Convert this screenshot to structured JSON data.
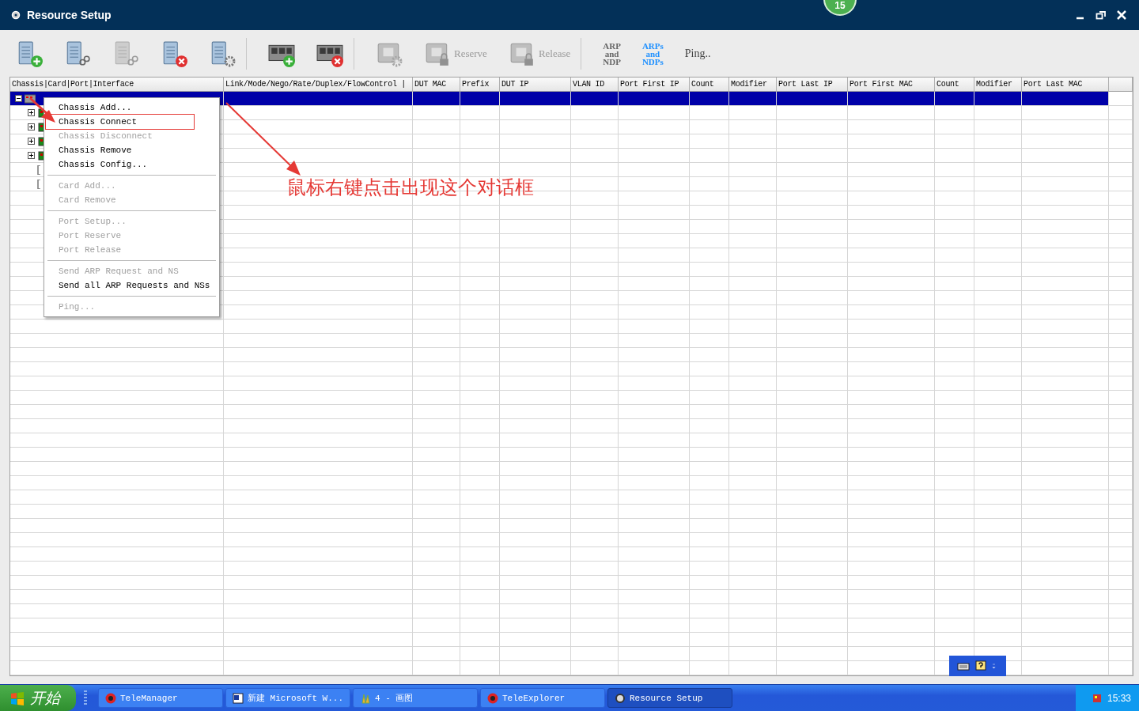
{
  "window": {
    "title": "Resource Setup",
    "badge": "15"
  },
  "toolbar": [
    {
      "kind": "icon",
      "disabled": false
    },
    {
      "kind": "icon",
      "disabled": false
    },
    {
      "kind": "icon",
      "disabled": true
    },
    {
      "kind": "icon",
      "disabled": false
    },
    {
      "kind": "icon",
      "disabled": false
    },
    {
      "kind": "separator"
    },
    {
      "kind": "icon",
      "disabled": false
    },
    {
      "kind": "icon",
      "disabled": false
    },
    {
      "kind": "separator"
    },
    {
      "kind": "icon",
      "disabled": true
    },
    {
      "kind": "icon",
      "disabled": true,
      "label": "Reserve"
    },
    {
      "kind": "icon",
      "disabled": true,
      "label": "Release"
    },
    {
      "kind": "separator"
    },
    {
      "kind": "stack",
      "lines": [
        "ARP",
        "and",
        "NDP"
      ],
      "disabled": true
    },
    {
      "kind": "stack",
      "lines": [
        "ARPs",
        "and",
        "NDPs"
      ],
      "disabled": false
    },
    {
      "kind": "text",
      "label": "Ping..",
      "disabled": false
    }
  ],
  "table": {
    "columns": [
      "Chassis|Card|Port|Interface",
      "Link/Mode/Nego/Rate/Duplex/FlowControl  |",
      "DUT MAC",
      "Prefix",
      "DUT IP",
      "VLAN ID",
      "Port First IP",
      "Count",
      "Modifier",
      "Port Last IP",
      "Port First MAC",
      "Count",
      "Modifier",
      "Port Last MAC"
    ],
    "tree": [
      {
        "kind": "chassis",
        "selected": true,
        "expanded": true,
        "children": [
          {
            "kind": "card",
            "selected": false,
            "expanded": false
          },
          {
            "kind": "card",
            "selected": false,
            "expanded": false
          },
          {
            "kind": "card",
            "selected": false,
            "expanded": false
          },
          {
            "kind": "card",
            "selected": false,
            "expanded": false
          },
          {
            "kind": "port",
            "selected": false
          },
          {
            "kind": "port",
            "selected": false
          }
        ]
      }
    ]
  },
  "context_menu": [
    [
      {
        "label": "Chassis Add...",
        "disabled": false,
        "boxed": false
      },
      {
        "label": "Chassis Connect",
        "disabled": false,
        "boxed": true
      },
      {
        "label": "Chassis Disconnect",
        "disabled": true,
        "boxed": false
      },
      {
        "label": "Chassis Remove",
        "disabled": false,
        "boxed": false
      },
      {
        "label": "Chassis Config...",
        "disabled": false,
        "boxed": false
      }
    ],
    [
      {
        "label": "Card Add...",
        "disabled": true,
        "boxed": false
      },
      {
        "label": "Card Remove",
        "disabled": true,
        "boxed": false
      }
    ],
    [
      {
        "label": "Port Setup...",
        "disabled": true,
        "boxed": false
      },
      {
        "label": "Port Reserve",
        "disabled": true,
        "boxed": false
      },
      {
        "label": "Port Release",
        "disabled": true,
        "boxed": false
      }
    ],
    [
      {
        "label": "Send ARP Request and NS",
        "disabled": true,
        "boxed": false
      },
      {
        "label": "Send all ARP Requests and NSs",
        "disabled": false,
        "boxed": false
      }
    ],
    [
      {
        "label": "Ping...",
        "disabled": true,
        "boxed": false
      }
    ]
  ],
  "annotation": {
    "text": "鼠标右键点击出现这个对话框"
  },
  "taskbar": {
    "start": "开始",
    "tasks": [
      {
        "label": "TeleManager",
        "selected": false
      },
      {
        "label": "新建 Microsoft W...",
        "selected": false
      },
      {
        "label": "4 - 画图",
        "selected": false
      },
      {
        "label": "TeleExplorer",
        "selected": false
      },
      {
        "label": "Resource Setup",
        "selected": true
      }
    ],
    "clock": "15:33"
  }
}
